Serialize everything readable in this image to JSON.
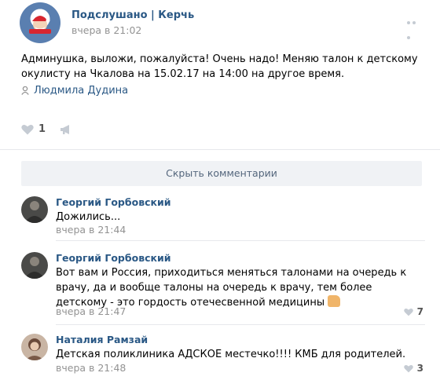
{
  "post": {
    "group_name": "Подслушано | Керчь",
    "time": "вчера в 21:02",
    "text": "Админушка, выложи, пожалуйста! Очень надо! Меняю талон к детскому окулисту на Чкалова на 15.02.17 на 14:00 на другое время.",
    "signer": "Людмила Дудина",
    "likes": "1"
  },
  "hide_comments_label": "Скрыть комментарии",
  "comments": [
    {
      "author": "Георгий Горбовский",
      "text": "Дожились...",
      "time": "вчера в 21:44",
      "likes": ""
    },
    {
      "author": "Георгий Горбовский",
      "text": "Вот вам и Россия, приходиться меняться талонами на очередь к врачу, да и вообще талоны на очередь к врачу, тем более детскому - это гордость отечесвенной медицины",
      "time": "вчера в 21:47",
      "likes": "7"
    },
    {
      "author": "Наталия Рамзай",
      "text": "Детская поликлиника АДСКОЕ местечко!!!! КМБ для родителей.",
      "time": "вчера в 21:48",
      "likes": "3"
    }
  ],
  "icons": {
    "like": "heart-icon",
    "share": "megaphone-icon",
    "more": "more-dots-icon",
    "signer": "person-icon",
    "thumbs": "thumbs-up-emoji"
  },
  "colors": {
    "link": "#2a5885",
    "muted": "#939393",
    "icon": "#c5cbd3",
    "button_bg": "#f0f2f5"
  }
}
